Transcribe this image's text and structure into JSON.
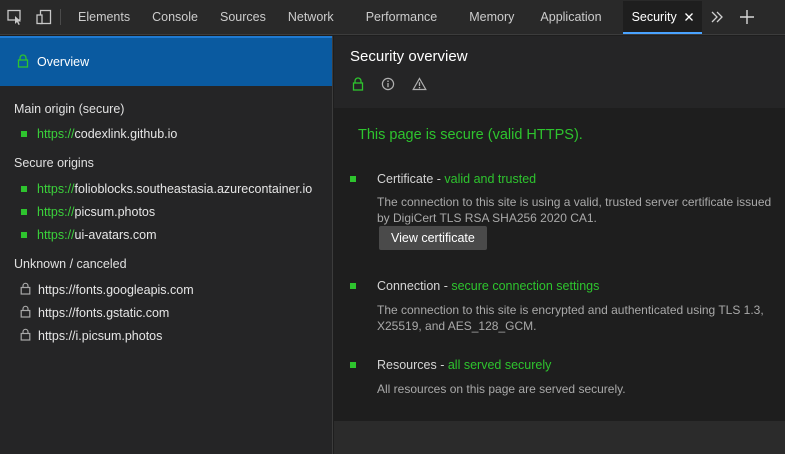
{
  "toolbar": {
    "icons": [
      "inspect-element-icon",
      "device-emulation-icon"
    ],
    "tabs": [
      {
        "label": "Elements"
      },
      {
        "label": "Console"
      },
      {
        "label": "Sources"
      },
      {
        "label": "Network"
      },
      {
        "label": "Performance"
      },
      {
        "label": "Memory"
      },
      {
        "label": "Application"
      },
      {
        "label": "Security",
        "active": true
      }
    ],
    "more_icon": "chevron-double-right-icon",
    "add_icon": "plus-icon"
  },
  "sidebar": {
    "overview_label": "Overview",
    "main_origin": {
      "heading": "Main origin (secure)",
      "items": [
        {
          "scheme": "https://",
          "host": "codexlink.github.io"
        }
      ]
    },
    "secure_origins": {
      "heading": "Secure origins",
      "items": [
        {
          "scheme": "https://",
          "host": "folioblocks.southeastasia.azurecontainer.io"
        },
        {
          "scheme": "https://",
          "host": "picsum.photos"
        },
        {
          "scheme": "https://",
          "host": "ui-avatars.com"
        }
      ]
    },
    "unknown_origins": {
      "heading": "Unknown / canceled",
      "items": [
        {
          "url": "https://fonts.googleapis.com"
        },
        {
          "url": "https://fonts.gstatic.com"
        },
        {
          "url": "https://i.picsum.photos"
        }
      ]
    }
  },
  "main": {
    "title": "Security overview",
    "summary": "This page is secure (valid HTTPS).",
    "certificate": {
      "title": "Certificate - ",
      "status": "valid and trusted",
      "description": "The connection to this site is using a valid, trusted server certificate issued by DigiCert TLS RSA SHA256 2020 CA1.",
      "button_label": "View certificate"
    },
    "connection": {
      "title": "Connection - ",
      "status": "secure connection settings",
      "description": "The connection to this site is encrypted and authenticated using TLS 1.3, X25519, and AES_128_GCM."
    },
    "resources": {
      "title": "Resources - ",
      "status": "all served securely",
      "description": "All resources on this page are served securely."
    }
  },
  "colors": {
    "accent": "#0a5aa0",
    "secure_green": "#2ec42e",
    "active_tab_underline": "#4aa3ff"
  }
}
